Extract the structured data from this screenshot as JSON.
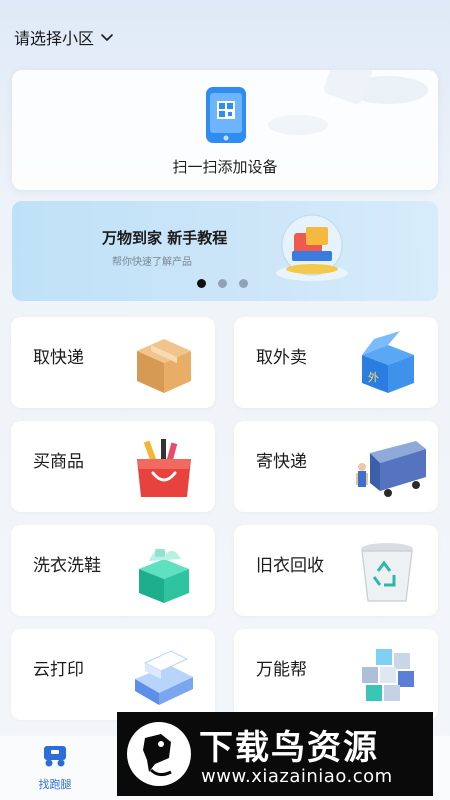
{
  "header": {
    "community_selector": "请选择小区"
  },
  "scan_card": {
    "label": "扫一扫添加设备"
  },
  "banner": {
    "title": "万物到家 新手教程",
    "subtitle": "帮你快速了解产品",
    "active_page": 1,
    "page_count": 3
  },
  "services": [
    {
      "label": "取快递",
      "icon": "parcel-box-icon"
    },
    {
      "label": "取外卖",
      "icon": "takeout-box-icon"
    },
    {
      "label": "买商品",
      "icon": "shopping-bag-icon"
    },
    {
      "label": "寄快递",
      "icon": "delivery-truck-icon"
    },
    {
      "label": "洗衣洗鞋",
      "icon": "laundry-box-icon"
    },
    {
      "label": "旧衣回收",
      "icon": "recycle-bin-icon"
    },
    {
      "label": "云打印",
      "icon": "printer-icon"
    },
    {
      "label": "万能帮",
      "icon": "cubes-icon"
    }
  ],
  "bottom_nav": {
    "items": [
      {
        "label": "找跑腿",
        "icon": "errand-icon",
        "active": true
      }
    ]
  },
  "watermark": {
    "title": "下载鸟资源",
    "url": "www.xiazainiao.com"
  },
  "colors": {
    "accent": "#2b6fd6",
    "banner_bg": "#c7e3f8",
    "page_bg": "#f4f6f9"
  }
}
